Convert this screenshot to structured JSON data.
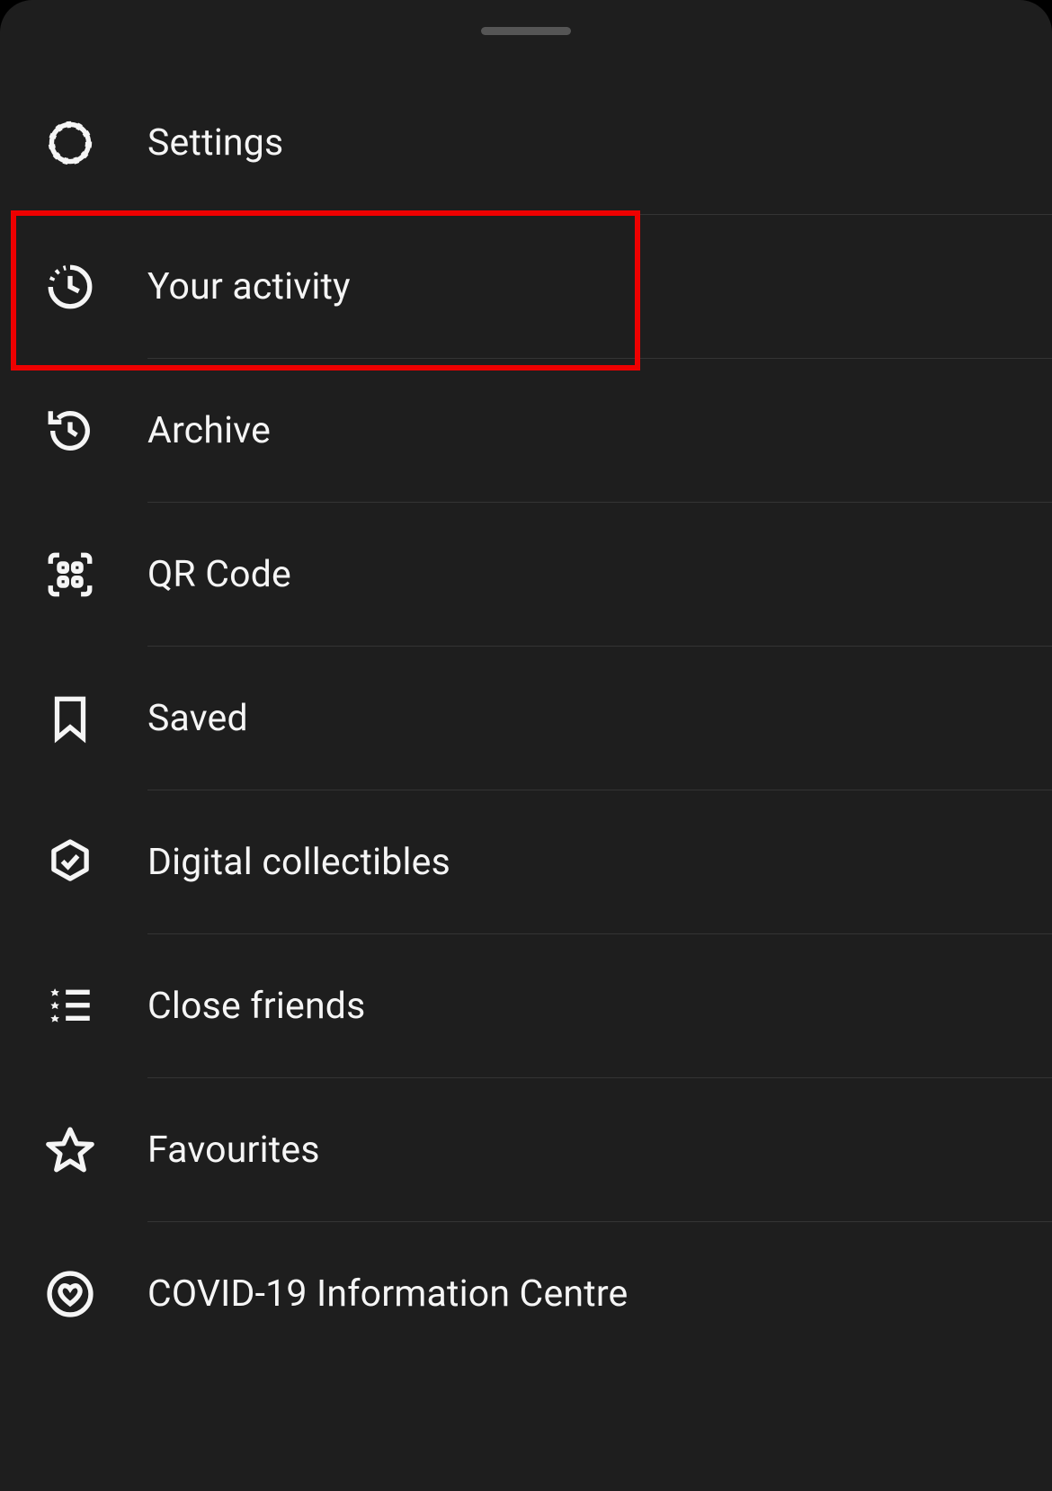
{
  "menu": {
    "items": [
      {
        "id": "settings",
        "label": "Settings",
        "icon": "gear-icon"
      },
      {
        "id": "your-activity",
        "label": "Your activity",
        "icon": "activity-clock-icon"
      },
      {
        "id": "archive",
        "label": "Archive",
        "icon": "archive-clock-icon"
      },
      {
        "id": "qr-code",
        "label": "QR Code",
        "icon": "qr-code-icon"
      },
      {
        "id": "saved",
        "label": "Saved",
        "icon": "bookmark-icon"
      },
      {
        "id": "digital-collectibles",
        "label": "Digital collectibles",
        "icon": "hex-check-icon"
      },
      {
        "id": "close-friends",
        "label": "Close friends",
        "icon": "star-list-icon"
      },
      {
        "id": "favourites",
        "label": "Favourites",
        "icon": "star-icon"
      },
      {
        "id": "covid",
        "label": "COVID-19 Information Centre",
        "icon": "heart-circle-icon"
      }
    ]
  },
  "highlight": {
    "index": 1
  }
}
